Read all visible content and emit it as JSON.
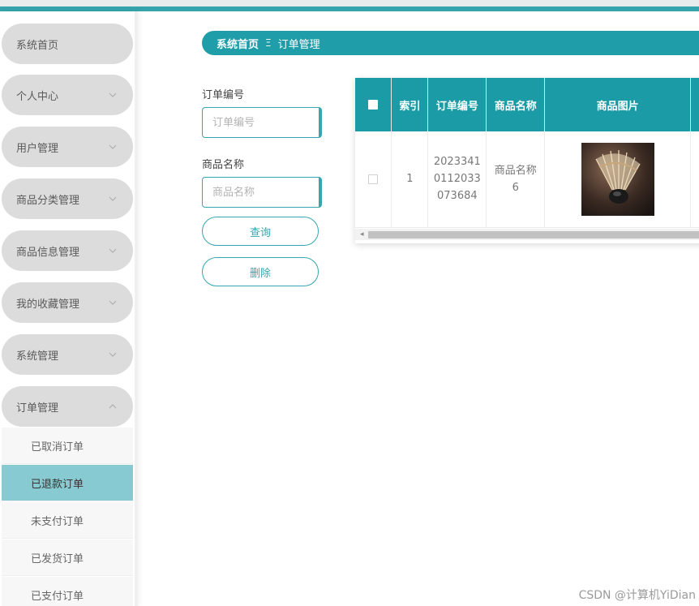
{
  "sidebar": {
    "items": [
      {
        "label": "系统首页",
        "has_chevron": false
      },
      {
        "label": "个人中心",
        "has_chevron": true
      },
      {
        "label": "用户管理",
        "has_chevron": true
      },
      {
        "label": "商品分类管理",
        "has_chevron": true
      },
      {
        "label": "商品信息管理",
        "has_chevron": true
      },
      {
        "label": "我的收藏管理",
        "has_chevron": true
      },
      {
        "label": "系统管理",
        "has_chevron": true
      },
      {
        "label": "订单管理",
        "has_chevron": true,
        "expanded": true
      }
    ],
    "submenu": [
      {
        "label": "已取消订单",
        "active": false
      },
      {
        "label": "已退款订单",
        "active": true
      },
      {
        "label": "未支付订单",
        "active": false
      },
      {
        "label": "已发货订单",
        "active": false
      },
      {
        "label": "已支付订单",
        "active": false
      }
    ]
  },
  "breadcrumb": {
    "home": "系统首页",
    "separator": "Ξ",
    "current": "订单管理"
  },
  "search": {
    "order_no_label": "订单编号",
    "order_no_placeholder": "订单编号",
    "product_name_label": "商品名称",
    "product_name_placeholder": "商品名称",
    "query_button": "查询",
    "delete_button": "删除"
  },
  "table": {
    "columns": [
      "",
      "索引",
      "订单编号",
      "商品名称",
      "商品图片"
    ],
    "rows": [
      {
        "index": "1",
        "order_no": "20233410112033073684",
        "order_no_lines": [
          "2023341",
          "0112033",
          "073684"
        ],
        "product_name": "商品名称6",
        "product_name_lines": [
          "商品名称",
          "6"
        ],
        "image": "shuttlecock-photo"
      }
    ]
  },
  "colors": {
    "accent": "#1f9ea9",
    "active_submenu": "#88cad1",
    "menu_pill": "#dcdcdc"
  },
  "watermark": "CSDN @计算机YiDian"
}
